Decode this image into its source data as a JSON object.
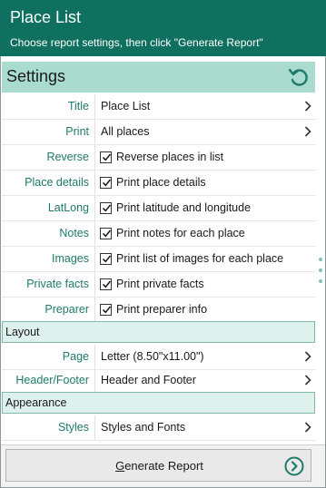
{
  "header": {
    "title": "Place List",
    "subtitle": "Choose report settings, then click \"Generate Report\""
  },
  "settings": {
    "label": "Settings",
    "refresh_icon": "refresh-icon"
  },
  "rows": {
    "title": {
      "label": "Title",
      "value": "Place List"
    },
    "print": {
      "label": "Print",
      "value": "All places"
    },
    "reverse": {
      "label": "Reverse",
      "text": "Reverse places in list",
      "checked": true
    },
    "place_details": {
      "label": "Place details",
      "text": "Print place details",
      "checked": true
    },
    "latlong": {
      "label": "LatLong",
      "text": "Print latitude and longitude",
      "checked": true
    },
    "notes": {
      "label": "Notes",
      "text": "Print notes for each place",
      "checked": true
    },
    "images": {
      "label": "Images",
      "text": "Print list of images for each place",
      "checked": true
    },
    "private_facts": {
      "label": "Private facts",
      "text": "Print private facts",
      "checked": true
    },
    "preparer": {
      "label": "Preparer",
      "text": "Print preparer info",
      "checked": true
    }
  },
  "layout": {
    "section_label": "Layout",
    "page": {
      "label": "Page",
      "value": "Letter (8.50\"x11.00\")"
    },
    "header_footer": {
      "label": "Header/Footer",
      "value": "Header and Footer"
    }
  },
  "appearance": {
    "section_label": "Appearance",
    "styles": {
      "label": "Styles",
      "value": "Styles and Fonts"
    }
  },
  "footer": {
    "generate_label": "Generate Report",
    "generate_icon": "arrow-circle-right-icon"
  },
  "colors": {
    "header_bg": "#0f7060",
    "settings_bg": "#a9dccf",
    "label_text": "#1f7a6b",
    "accent": "#1f7a6b"
  }
}
